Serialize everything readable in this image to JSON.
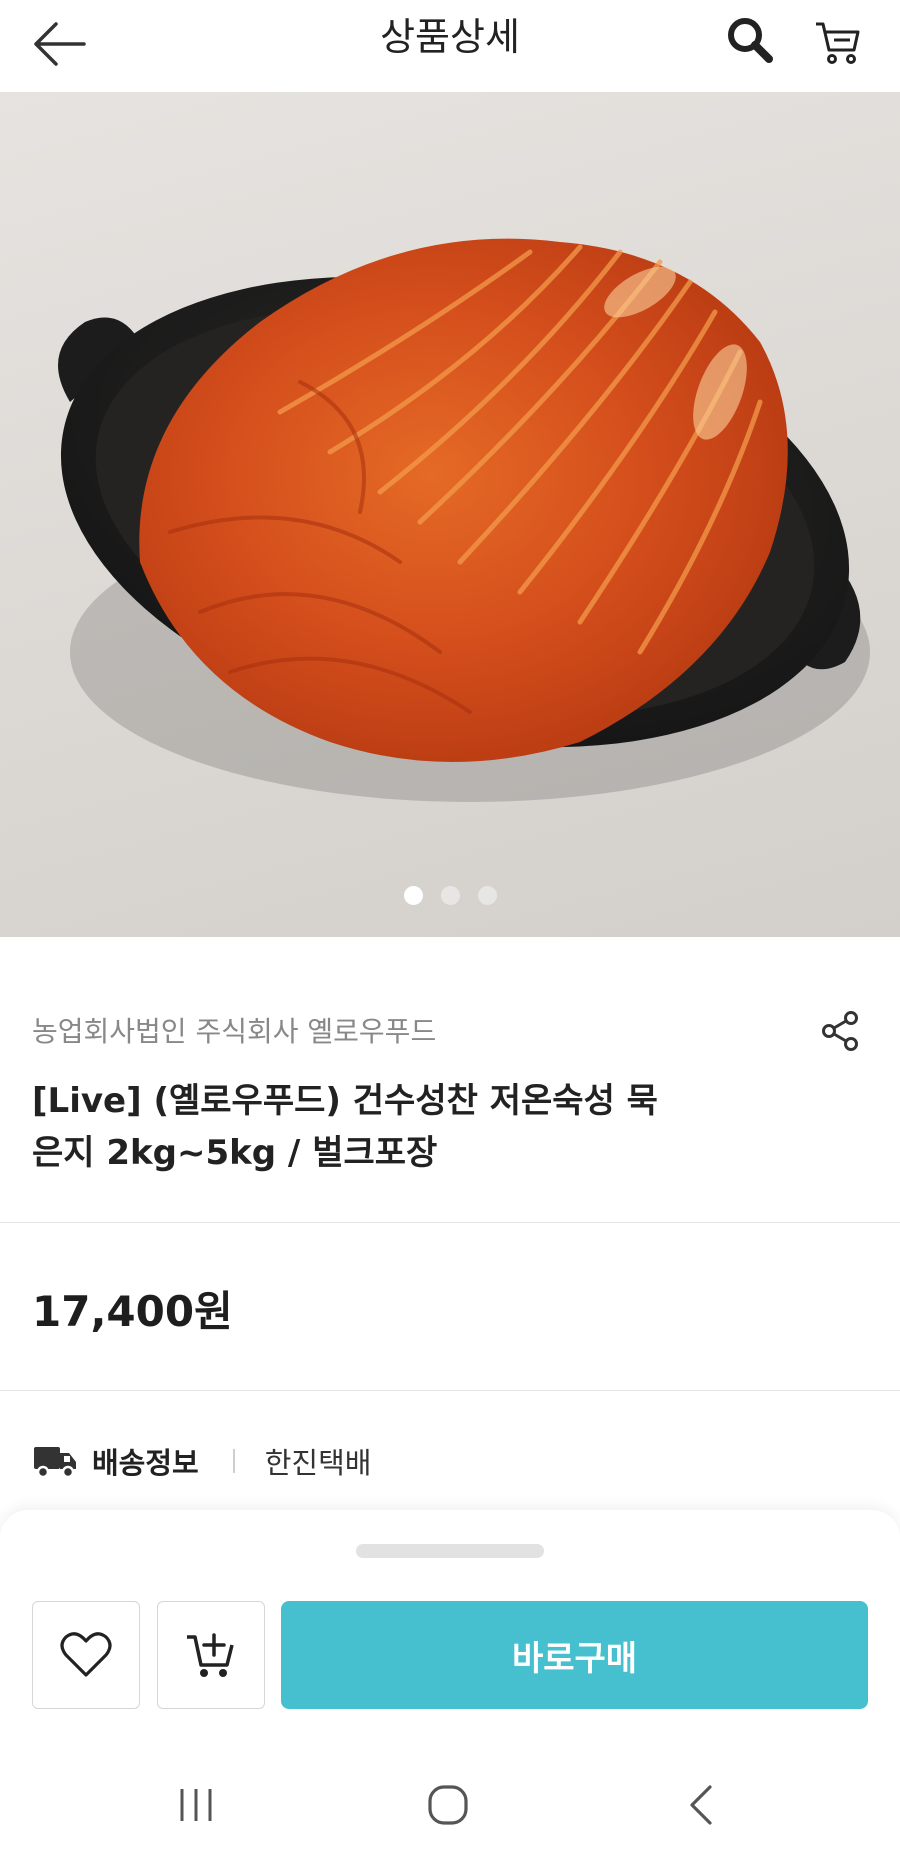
{
  "header": {
    "title": "상품상세",
    "back_icon": "arrow-left-icon",
    "search_icon": "search-icon",
    "cart_icon": "cart-icon"
  },
  "gallery": {
    "image_description_icon": "kimchi-product-image",
    "page_count": 3,
    "active_index": 0
  },
  "product": {
    "seller": "농업회사법인 주식회사 옐로우푸드",
    "title_line1": "[Live] (옐로우푸드) 건수성찬 저온숙성 묵",
    "title_line2": "은지 2kg~5kg / 벌크포장",
    "price": "17,400원"
  },
  "shipping": {
    "label": "배송정보",
    "value": "한진택배"
  },
  "actions": {
    "wishlist_icon": "heart-icon",
    "add_cart_icon": "cart-plus-icon",
    "buy_label": "바로구매"
  },
  "colors": {
    "accent": "#46c0cf",
    "price": "#1e1e1e",
    "seller": "#888888"
  },
  "system_nav": {
    "recent_icon": "recent-apps-icon",
    "home_icon": "home-icon",
    "back_icon": "nav-back-icon"
  }
}
